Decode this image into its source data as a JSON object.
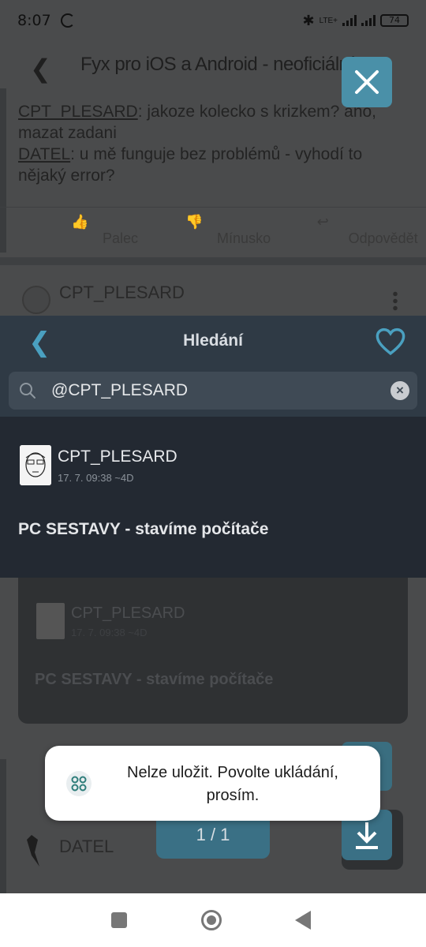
{
  "status_bar": {
    "time": "8:07",
    "network": "LTE+",
    "battery": "74"
  },
  "background": {
    "topbar_title": "Fyx pro iOS a Android - neoficiální",
    "post_text": [
      {
        "link": "CPT_PLESARD",
        "text": ": jakoze kolecko s krizkem? ano, mazat zadani"
      },
      {
        "link": "DATEL",
        "text": ": u mě funguje bez problémů - vyhodí to nějaký error?"
      }
    ],
    "actions": {
      "like": "Palec",
      "dislike": "Mínusko",
      "reply": "Odpovědět"
    },
    "post2_user": "CPT_PLESARD",
    "card": {
      "user": "CPT_PLESARD",
      "date": "17. 7. 09:38 ~4D",
      "topic": "PC SESTAVY - stavíme počítače"
    },
    "datel_user": "DATEL"
  },
  "search_panel": {
    "title": "Hledání",
    "query": "@CPT_PLESARD",
    "result": {
      "user": "CPT_PLESARD",
      "date": "17. 7. 09:38 ~4D",
      "topic": "PC SESTAVY - stavíme počítače"
    }
  },
  "pager": {
    "label": "1 / 1"
  },
  "toast": {
    "message": "Nelze uložit. Povolte ukládání, prosím."
  },
  "icons": {
    "back": "chevron-left-icon",
    "favorite": "heart-outline-icon",
    "search": "search-icon",
    "clear": "clear-circle-icon",
    "close": "close-icon",
    "download": "download-icon"
  },
  "colors": {
    "accent": "#4a90a8",
    "header_bg": "#2f3a45",
    "panel_bg": "#232932",
    "heart": "#4aa0c0"
  }
}
